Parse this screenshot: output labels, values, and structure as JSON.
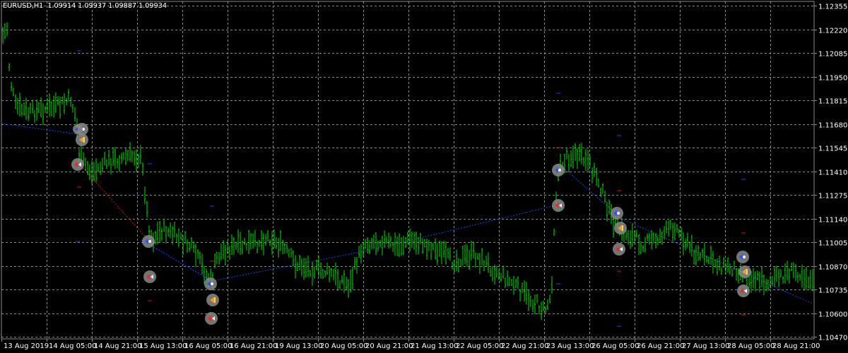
{
  "chart": {
    "symbol_timeframe": "EURUSD,H1",
    "ohlc": [
      "1.09914",
      "1.09937",
      "1.09887",
      "1.09934"
    ],
    "colors": {
      "background": "#000000",
      "grid": "#8a8a8a",
      "bars": "#00e000",
      "axis_text": "#ffffff",
      "trend_blue": "#2040ff",
      "trend_red": "#e01010",
      "marker_bg": "#8a8a8a"
    },
    "price_labels": [
      "1.12355",
      "1.12220",
      "1.12085",
      "1.11950",
      "1.11815",
      "1.11680",
      "1.11545",
      "1.11410",
      "1.11275",
      "1.11140",
      "1.11005",
      "1.10870",
      "1.10735",
      "1.10600",
      "1.10470"
    ],
    "time_labels": [
      "13 Aug 2019",
      "14 Aug 05:00",
      "14 Aug 21:00",
      "15 Aug 13:00",
      "16 Aug 05:00",
      "16 Aug 21:00",
      "19 Aug 13:00",
      "20 Aug 05:00",
      "20 Aug 21:00",
      "21 Aug 13:00",
      "22 Aug 05:00",
      "22 Aug 21:00",
      "23 Aug 13:00",
      "26 Aug 05:00",
      "26 Aug 21:00",
      "27 Aug 13:00",
      "28 Aug 05:00",
      "28 Aug 21:00"
    ],
    "markers": [
      {
        "type": "buy",
        "label": "buy-arrow-marker"
      },
      {
        "type": "close",
        "label": "close-marker"
      },
      {
        "type": "sell",
        "label": "sell-arrow-marker"
      },
      {
        "type": "buy",
        "label": "buy-arrow-marker"
      },
      {
        "type": "sell",
        "label": "sell-arrow-marker"
      },
      {
        "type": "buy",
        "label": "buy-arrow-marker"
      },
      {
        "type": "close",
        "label": "close-marker"
      },
      {
        "type": "sell",
        "label": "sell-arrow-marker"
      },
      {
        "type": "buy",
        "label": "buy-arrow-marker"
      },
      {
        "type": "sell",
        "label": "sell-arrow-marker"
      },
      {
        "type": "buy",
        "label": "buy-arrow-marker"
      },
      {
        "type": "close",
        "label": "close-marker"
      },
      {
        "type": "sell",
        "label": "sell-arrow-marker"
      },
      {
        "type": "buy",
        "label": "buy-arrow-marker"
      },
      {
        "type": "close",
        "label": "close-marker"
      },
      {
        "type": "sell",
        "label": "sell-arrow-marker"
      }
    ]
  }
}
